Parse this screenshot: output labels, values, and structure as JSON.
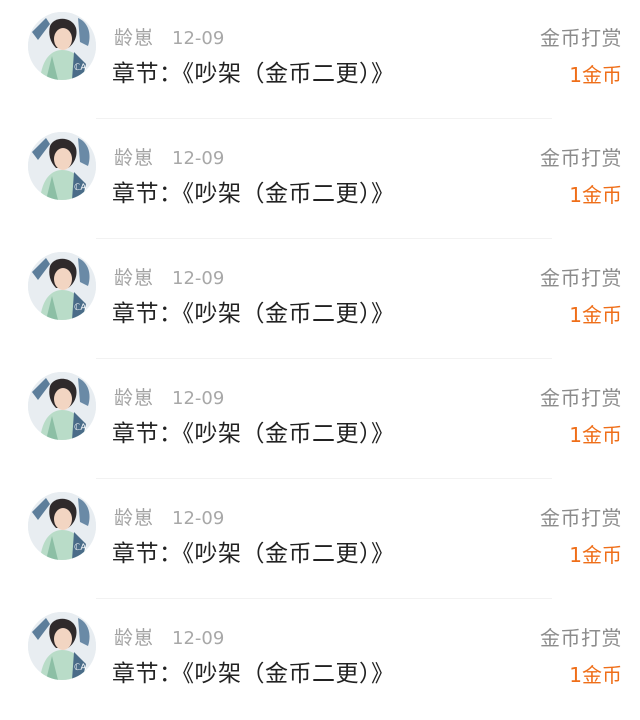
{
  "rewards": [
    {
      "user": "龄崽",
      "date": "12-09",
      "chapter": "章节：《吵架（金币二更）》",
      "type": "金币打赏",
      "amount": "1金币"
    },
    {
      "user": "龄崽",
      "date": "12-09",
      "chapter": "章节：《吵架（金币二更）》",
      "type": "金币打赏",
      "amount": "1金币"
    },
    {
      "user": "龄崽",
      "date": "12-09",
      "chapter": "章节：《吵架（金币二更）》",
      "type": "金币打赏",
      "amount": "1金币"
    },
    {
      "user": "龄崽",
      "date": "12-09",
      "chapter": "章节：《吵架（金币二更）》",
      "type": "金币打赏",
      "amount": "1金币"
    },
    {
      "user": "龄崽",
      "date": "12-09",
      "chapter": "章节：《吵架（金币二更）》",
      "type": "金币打赏",
      "amount": "1金币"
    },
    {
      "user": "龄崽",
      "date": "12-09",
      "chapter": "章节：《吵架（金币二更）》",
      "type": "金币打赏",
      "amount": "1金币"
    }
  ],
  "colors": {
    "amount": "#ef6e18",
    "username": "#a3a3a3",
    "type": "#8c8c8c",
    "chapter": "#222222"
  }
}
